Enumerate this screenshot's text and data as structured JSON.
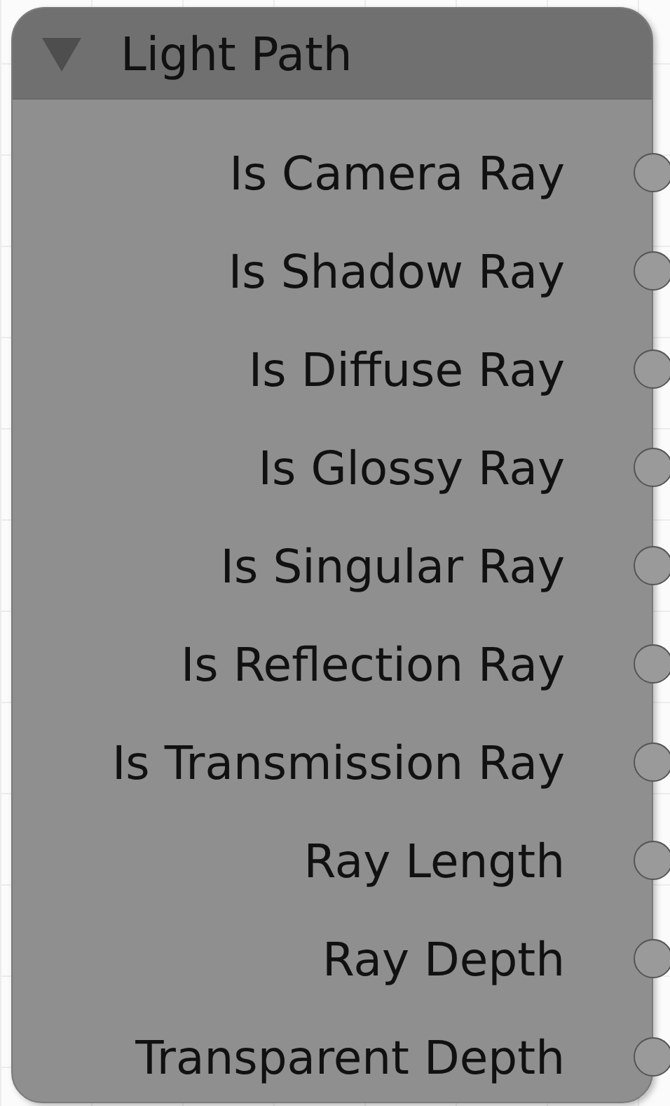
{
  "node": {
    "title": "Light Path",
    "expanded": true,
    "outputs": [
      {
        "label": "Is Camera Ray"
      },
      {
        "label": "Is Shadow Ray"
      },
      {
        "label": "Is Diffuse Ray"
      },
      {
        "label": "Is Glossy Ray"
      },
      {
        "label": "Is Singular Ray"
      },
      {
        "label": "Is Reflection Ray"
      },
      {
        "label": "Is Transmission Ray"
      },
      {
        "label": "Ray Length"
      },
      {
        "label": "Ray Depth"
      },
      {
        "label": "Transparent Depth"
      }
    ]
  }
}
